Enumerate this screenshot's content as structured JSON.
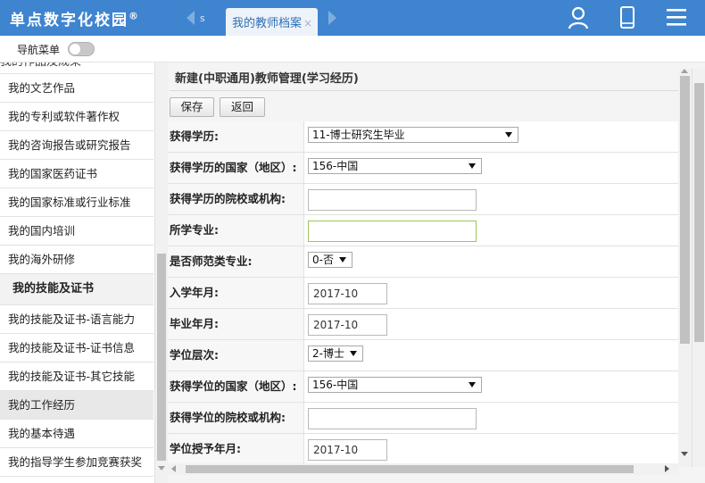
{
  "header": {
    "brand": "单点数字化校园",
    "brand_mark": "®",
    "tab_stub": "s",
    "active_tab": "我的教师档案",
    "active_tab_close": "×",
    "icons": [
      "user-icon",
      "phone-icon",
      "menu-icon"
    ],
    "bg_color": "#3f84cf"
  },
  "subbar": {
    "nav_label": "导航菜单",
    "toggle_on": false
  },
  "sidebar": {
    "cut_item": "我的作品及成果",
    "items_top": [
      "我的文艺作品",
      "我的专利或软件著作权",
      "我的咨询报告或研究报告",
      "我的国家医药证书",
      "我的国家标准或行业标准",
      "我的国内培训",
      "我的海外研修"
    ],
    "group": "我的技能及证书",
    "items_bottom": [
      "我的技能及证书-语言能力",
      "我的技能及证书-证书信息",
      "我的技能及证书-其它技能",
      "我的工作经历",
      "我的基本待遇",
      "我的指导学生参加竞赛获奖"
    ],
    "active_item": "我的工作经历"
  },
  "main": {
    "title": "新建(中职通用)教师管理(学习经历)",
    "save_label": "保存",
    "back_label": "返回",
    "fields": [
      {
        "label": "获得学历:",
        "type": "select",
        "value": "11-博士研究生毕业"
      },
      {
        "label": "获得学历的国家（地区）:",
        "type": "select",
        "value": "156-中国"
      },
      {
        "label": "获得学历的院校或机构:",
        "type": "text",
        "value": ""
      },
      {
        "label": "所学专业:",
        "type": "text",
        "value": ""
      },
      {
        "label": "是否师范类专业:",
        "type": "select",
        "value": "0-否"
      },
      {
        "label": "入学年月:",
        "type": "text",
        "value": "2017-10"
      },
      {
        "label": "毕业年月:",
        "type": "text",
        "value": "2017-10"
      },
      {
        "label": "学位层次:",
        "type": "select",
        "value": "2-博士"
      },
      {
        "label": "获得学位的国家（地区）:",
        "type": "select",
        "value": "156-中国"
      },
      {
        "label": "获得学位的院校或机构:",
        "type": "text",
        "value": ""
      },
      {
        "label": "学位授予年月:",
        "type": "text",
        "value": "2017-10"
      }
    ]
  }
}
